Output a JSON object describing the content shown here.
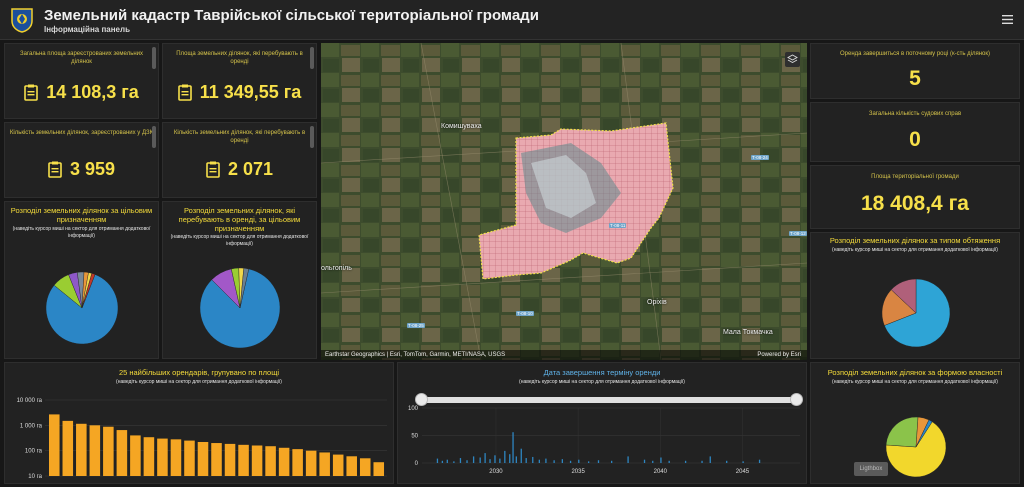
{
  "header": {
    "title": "Земельний кадастр Таврійської сільської територіальної громади",
    "subtitle": "Інформаційна панель"
  },
  "kpis": {
    "total_area": {
      "caption": "Загальна площа зареєстрованих земельних ділянок",
      "value": "14 108,3 га"
    },
    "lease_area": {
      "caption": "Площа земельних ділянок, які перебувають в оренді",
      "value": "11 349,55 га"
    },
    "count_dzk": {
      "caption": "Кількість земельних ділянок, зареєстрованих у ДЗК",
      "value": "3 959"
    },
    "count_lease": {
      "caption": "Кількість земельних ділянок, які перебувають в оренді",
      "value": "2 071"
    },
    "lease_ending": {
      "caption": "Оренда завершиться в поточному році (к-сть ділянок)",
      "value": "5"
    },
    "disputes": {
      "caption": "Загальна кількість судових справ",
      "value": "0"
    },
    "community_area": {
      "caption": "Площа територіальної громади",
      "value": "18 408,4 га"
    }
  },
  "hint": "(наведіть курсор миші на сектор для отримання додаткової інформації)",
  "pie_purpose": {
    "title": "Розподіл земельних ділянок за цільовим призначенням"
  },
  "pie_lease_purpose": {
    "title": "Розподіл земельних ділянок, які перебувають в оренді, за цільовим призначенням"
  },
  "pie_encumbrance": {
    "title": "Розподіл земельних ділянок за типом обтяження"
  },
  "pie_ownership": {
    "title": "Розподіл земельних ділянок за формою власності"
  },
  "tenants_chart": {
    "title": "25 найбільших орендарів, групувано по площі"
  },
  "lease_end_chart": {
    "title": "Дата завершення терміну оренди"
  },
  "map": {
    "attribution": "Earthstar Geographics | Esri, TomTom, Garmin, METI/NASA, USGS",
    "powered_by": "Powered by Esri",
    "places": [
      "Комишуваха",
      "Оріхів",
      "Мала Токмачка",
      "ольгопіль"
    ],
    "road_tags": [
      "Т-08-11",
      "Т-08-10",
      "Т-08-24",
      "Т-08-12",
      "Т-08-25"
    ]
  },
  "lightbox_label": "Ligthbox",
  "colors": {
    "accent": "#f7e04a",
    "blue_title": "#5fb2e8",
    "bar": "#f5a623",
    "pie_blue": "#2e86c1"
  },
  "chart_data": [
    {
      "type": "pie",
      "title": "Розподіл земельних ділянок за цільовим призначенням",
      "values": [
        80,
        8,
        4,
        3,
        2,
        1.5,
        1.5
      ],
      "colors": [
        "#2b86c6",
        "#9acd32",
        "#8e58c8",
        "#7a8a99",
        "#e8963a",
        "#f0d84a",
        "#c0392b"
      ]
    },
    {
      "type": "pie",
      "title": "Розподіл земельних ділянок, які перебувають в оренді, за цільовим призначенням",
      "values": [
        84,
        9,
        3,
        2,
        2
      ],
      "colors": [
        "#2b86c6",
        "#a258c8",
        "#9acd32",
        "#f0d84a",
        "#6a7f90"
      ]
    },
    {
      "type": "pie",
      "title": "Розподіл земельних ділянок за типом обтяження",
      "values": [
        69,
        18,
        13
      ],
      "colors": [
        "#2ea4d6",
        "#d98542",
        "#b0607a"
      ]
    },
    {
      "type": "pie",
      "title": "Розподіл земельних ділянок за формою власності",
      "values": [
        67,
        25,
        6,
        2
      ],
      "colors": [
        "#f2d72c",
        "#8bc34a",
        "#e8963a",
        "#2b86c6"
      ]
    },
    {
      "type": "bar",
      "title": "25 найбільших орендарів, групувано по площі",
      "yscale": "log",
      "ylim": [
        10,
        10000
      ],
      "yticks": [
        "10 000 га",
        "1 000 га",
        "100 га",
        "10 га"
      ],
      "values": [
        2700,
        1500,
        1150,
        1000,
        880,
        650,
        400,
        340,
        300,
        280,
        250,
        220,
        200,
        185,
        170,
        160,
        150,
        130,
        115,
        100,
        85,
        70,
        60,
        50,
        35
      ]
    },
    {
      "type": "bar",
      "title": "Дата завершення терміну оренди",
      "ylim": [
        0,
        100
      ],
      "yticks": [
        "100",
        "50",
        "0"
      ],
      "xticks": [
        "2030",
        "2035",
        "2040",
        "2045"
      ],
      "x": [
        2026.4,
        2026.7,
        2027.0,
        2027.4,
        2027.8,
        2028.2,
        2028.6,
        2029.0,
        2029.3,
        2029.6,
        2029.9,
        2030.2,
        2030.5,
        2030.8,
        2031.0,
        2031.2,
        2031.5,
        2031.8,
        2032.2,
        2032.6,
        2033.0,
        2033.5,
        2034.0,
        2034.5,
        2035.0,
        2035.6,
        2036.2,
        2037.0,
        2038.0,
        2039.0,
        2039.5,
        2040.0,
        2040.5,
        2041.5,
        2042.5,
        2043.0,
        2044.0,
        2045.0,
        2046.0
      ],
      "values": [
        8,
        4,
        6,
        3,
        9,
        5,
        12,
        10,
        18,
        7,
        14,
        8,
        22,
        16,
        56,
        12,
        26,
        9,
        11,
        6,
        8,
        5,
        7,
        4,
        6,
        3,
        5,
        4,
        12,
        6,
        4,
        10,
        4,
        4,
        4,
        12,
        4,
        3,
        6
      ]
    }
  ]
}
